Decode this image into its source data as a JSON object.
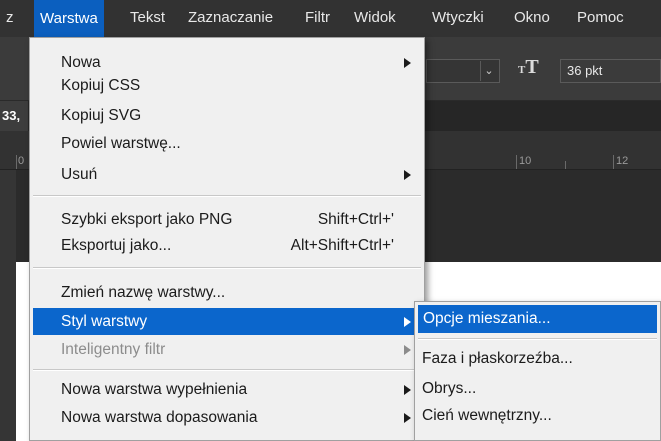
{
  "menubar": {
    "items": [
      "z",
      "Warstwa",
      "Tekst",
      "Zaznaczanie",
      "Filtr",
      "Widok",
      "Wtyczki",
      "Okno",
      "Pomoc"
    ],
    "active": "Warstwa"
  },
  "options": {
    "text_icon": "text-orientation-icon",
    "font_size": "36 pkt"
  },
  "doc_tab": {
    "label": "33,"
  },
  "ruler": {
    "labels": [
      "0",
      "10",
      "12"
    ]
  },
  "layer_menu": {
    "items": [
      {
        "label": "Nowa",
        "submenu": true
      },
      {
        "label": "Kopiuj CSS"
      },
      {
        "label": "Kopiuj SVG"
      },
      {
        "label": "Powiel warstwę..."
      },
      {
        "label": "Usuń",
        "submenu": true
      },
      {
        "label": "Szybki eksport jako PNG",
        "shortcut": "Shift+Ctrl+'"
      },
      {
        "label": "Eksportuj jako...",
        "shortcut": "Alt+Shift+Ctrl+'"
      },
      {
        "label": "Zmień nazwę warstwy..."
      },
      {
        "label": "Styl warstwy",
        "submenu": true,
        "highlighted": true
      },
      {
        "label": "Inteligentny filtr",
        "submenu": true,
        "disabled": true
      },
      {
        "label": "Nowa warstwa wypełnienia",
        "submenu": true
      },
      {
        "label": "Nowa warstwa dopasowania",
        "submenu": true
      }
    ]
  },
  "style_submenu": {
    "items": [
      {
        "label": "Opcje mieszania...",
        "highlighted": true
      },
      {
        "label": "Faza i płaskorzeźba..."
      },
      {
        "label": "Obrys..."
      },
      {
        "label": "Cień wewnętrzny..."
      }
    ]
  },
  "colors": {
    "highlight": "#0b66cc",
    "menubar_active": "#0b5fbf",
    "menu_bg": "#f0f0f0"
  }
}
